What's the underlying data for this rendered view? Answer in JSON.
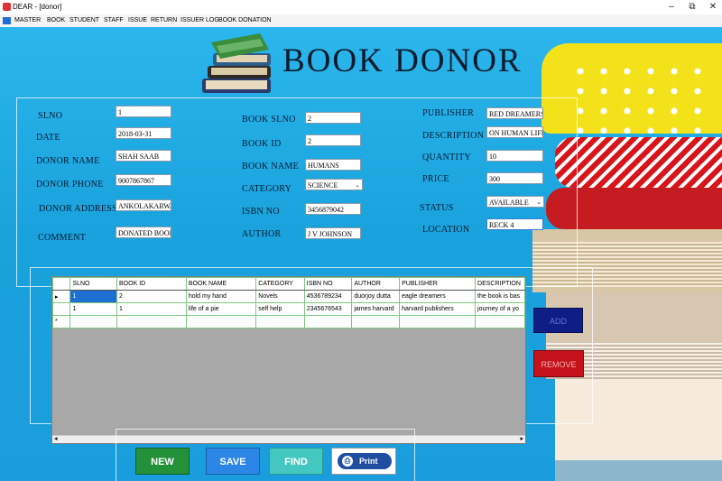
{
  "window": {
    "title": "DEAR - [donor]"
  },
  "menu": [
    "MASTER",
    "BOOK",
    "STUDENT",
    "STAFF",
    "ISSUE",
    "RETURN",
    "ISSUER LOG",
    "BOOK DONATION"
  ],
  "heading": "BOOK DONOR",
  "form": {
    "slno": {
      "label": "SLNO",
      "value": "1"
    },
    "date": {
      "label": "DATE",
      "value": "2018-03-31"
    },
    "donor_name": {
      "label": "DONOR NAME",
      "value": "SHAH SAAB"
    },
    "donor_phone": {
      "label": "DONOR PHONE",
      "value": "9007867867"
    },
    "donor_address": {
      "label": "DONOR ADDRESS",
      "value": "ANKOLAKARWAR"
    },
    "comment": {
      "label": "COMMENT",
      "value": "DONATED BOOK"
    },
    "book_slno": {
      "label": "BOOK SLNO",
      "value": "2"
    },
    "book_id": {
      "label": "BOOK ID",
      "value": "2"
    },
    "book_name": {
      "label": "BOOK NAME",
      "value": "HUMANS"
    },
    "category": {
      "label": "CATEGORY",
      "value": "SCIENCE"
    },
    "isbn_no": {
      "label": "ISBN NO",
      "value": "3456879042"
    },
    "author": {
      "label": "AUTHOR",
      "value": "J V JOHNSON"
    },
    "publisher": {
      "label": "PUBLISHER",
      "value": "RED DREAMERS"
    },
    "description": {
      "label": "DESCRIPTION",
      "value": "ON HUMAN LIFES"
    },
    "quantity": {
      "label": "QUANTITY",
      "value": "10"
    },
    "price": {
      "label": "PRICE",
      "value": "300"
    },
    "status": {
      "label": "STATUS",
      "value": "AVAILABLE"
    },
    "location": {
      "label": "LOCATION",
      "value": "RECK 4"
    }
  },
  "grid": {
    "columns": [
      "SLNO",
      "BOOK  ID",
      "BOOK  NAME",
      "CATEGORY",
      "ISBN  NO",
      "AUTHOR",
      "PUBLISHER",
      "DESCRIPTION"
    ],
    "rows": [
      [
        "1",
        "2",
        "hold my hand",
        "Novels",
        "4536789234",
        "duorjoy dutta",
        "eagle dreamers",
        "the book is bas"
      ],
      [
        "1",
        "1",
        "life of a pie",
        "self help",
        "2345676543",
        "james harvard",
        "harvard publishers",
        "journey of a yo"
      ]
    ],
    "new_row_marker": "*",
    "current_row_marker": "▸"
  },
  "side_buttons": {
    "add": "ADD",
    "remove": "REMOVE"
  },
  "buttons": {
    "new": "NEW",
    "save": "SAVE",
    "find": "FIND",
    "print": "Print"
  }
}
